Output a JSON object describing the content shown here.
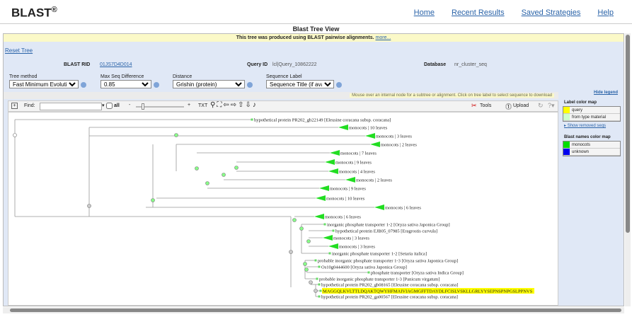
{
  "header": {
    "logo": "BLAST",
    "logo_mark": "®",
    "nav": [
      "Home",
      "Recent Results",
      "Saved Strategies",
      "Help"
    ]
  },
  "page_title": "Blast Tree View",
  "notice": {
    "text": "This tree was produced using BLAST pairwise alignments.",
    "link": "more..."
  },
  "reset_tree": "Reset Tree",
  "info": {
    "rid_label": "BLAST RID",
    "rid": "01JS7D4D014",
    "query_label": "Query ID",
    "query": "lcl|Query_10862222",
    "db_label": "Database",
    "db": "nr_cluster_seq"
  },
  "controls": {
    "tree_method": {
      "label": "Tree method",
      "value": "Fast Minimum Evolution"
    },
    "max_diff": {
      "label": "Max Seq Difference",
      "value": "0.85"
    },
    "distance": {
      "label": "Distance",
      "value": "Grishin (protein)"
    },
    "seq_label": {
      "label": "Sequence Label",
      "value": "Sequence Title (if avail"
    }
  },
  "hint": "Mouse over an internal node for a subtree or alignment. Click on tree label to select sequence to download",
  "toolbar": {
    "find": "Find:",
    "all": "all",
    "txt": "TXT",
    "tools": "Tools",
    "upload": "Upload"
  },
  "legend": {
    "hide": "Hide legend",
    "label_map_title": "Label color map",
    "label_map": [
      {
        "name": "query",
        "color": "#ffff00"
      },
      {
        "name": "from type material",
        "color": "#ccffcc"
      }
    ],
    "show_removed": "Show removed seqs",
    "names_map_title": "Blast names color map",
    "names_map": [
      {
        "name": "monocots",
        "color": "#00dd00"
      },
      {
        "name": "unknown",
        "color": "#0000ee"
      }
    ]
  },
  "tree": {
    "leaves": [
      {
        "label": "hypothetical protein PR202_gb22149 [Eleusine coracana subsp. coracana]",
        "collapsed": false
      },
      {
        "label": "monocots | 10 leaves",
        "collapsed": true
      },
      {
        "label": "monocots | 3 leaves",
        "collapsed": true
      },
      {
        "label": "monocots | 2 leaves",
        "collapsed": true
      },
      {
        "label": "monocots | 7 leaves",
        "collapsed": true
      },
      {
        "label": "monocots | 9 leaves",
        "collapsed": true
      },
      {
        "label": "monocots | 4 leaves",
        "collapsed": true
      },
      {
        "label": "monocots | 2 leaves",
        "collapsed": true
      },
      {
        "label": "monocots | 9 leaves",
        "collapsed": true
      },
      {
        "label": "monocots | 10 leaves",
        "collapsed": true
      },
      {
        "label": "monocots | 6 leaves",
        "collapsed": true
      },
      {
        "label": "monocots | 6 leaves",
        "collapsed": true
      },
      {
        "label": "inorganic phosphate transporter 1-2 [Oryza sativa Japonica Group]",
        "collapsed": false
      },
      {
        "label": "hypothetical protein EJB05_07985 [Eragrostis curvula]",
        "collapsed": false
      },
      {
        "label": "monocots | 3 leaves",
        "collapsed": true
      },
      {
        "label": "monocots | 3 leaves",
        "collapsed": true
      },
      {
        "label": "inorganic phosphate transporter 1-2 [Setaria italica]",
        "collapsed": false
      },
      {
        "label": "probable inorganic phosphate transporter 1-3 [Oryza sativa Japonica Group]",
        "collapsed": false
      },
      {
        "label": "Os10g0444600 [Oryza sativa Japonica Group]",
        "collapsed": false
      },
      {
        "label": "phosphate transporter [Oryza sativa Indica Group]",
        "collapsed": false
      },
      {
        "label": "probable inorganic phosphate transporter 1-3 [Panicum virgatum]",
        "collapsed": false
      },
      {
        "label": "hypothetical protein PR202_gb08165 [Eleusine coracana subsp. coracana]",
        "collapsed": false
      },
      {
        "label": "MAGGQLKVLTTLDQAKTQWYHFMAIVIAGMGFFTDAYDLFCISLVSKLLGRLYYSEPNSPNPGSLPPNVS",
        "collapsed": false,
        "query": true
      },
      {
        "label": "hypothetical protein PR202_ga00567 [Eleusine coracana subsp. coracana]",
        "collapsed": false
      }
    ]
  }
}
